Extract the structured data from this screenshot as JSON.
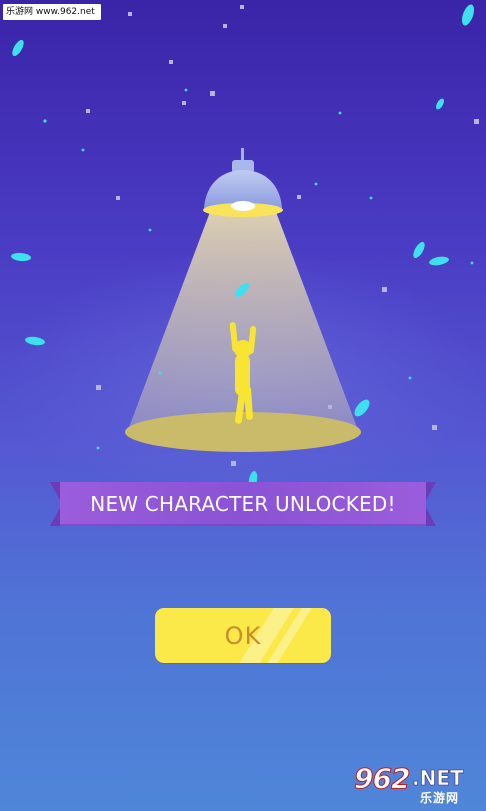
{
  "watermark": {
    "top_text": "乐游网 www.962.net",
    "bottom_number": "962",
    "bottom_domain": ".NET",
    "bottom_cn": "乐游网"
  },
  "banner": {
    "text": "NEW CHARACTER UNLOCKED!"
  },
  "ok_button": {
    "label": "OK"
  },
  "colors": {
    "background_top": "#3a24a8",
    "background_bottom": "#4f86d8",
    "banner": "#8a52d6",
    "button": "#fbe94a",
    "button_text": "#c98c2e",
    "character": "#f7e433",
    "spotlight_floor": "#c9bb6a",
    "lamp": "#9fb1e6",
    "petal": "#3ee0ee",
    "confetti": "#b9b2dc"
  },
  "icons": {
    "lamp": "ceiling-lamp-icon",
    "character": "dancing-stickman-icon"
  }
}
